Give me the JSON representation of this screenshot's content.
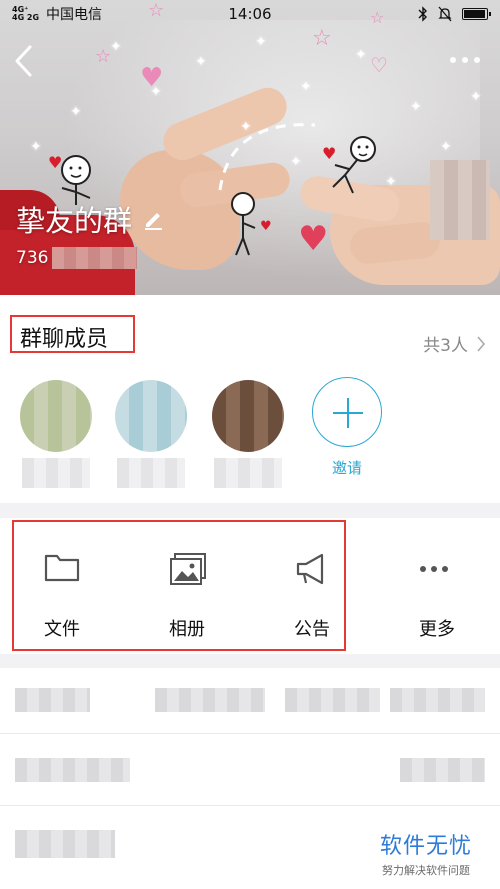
{
  "status_bar": {
    "signal": "4G⁺ 4G\n2G",
    "carrier": "中国电信",
    "time": "14:06"
  },
  "header": {
    "group_name": "挚友的群",
    "group_id_prefix": "736"
  },
  "members": {
    "title": "群聊成员",
    "count_label": "共3人",
    "invite_label": "邀请"
  },
  "actions": [
    {
      "label": "文件",
      "icon": "folder-icon"
    },
    {
      "label": "相册",
      "icon": "album-icon"
    },
    {
      "label": "公告",
      "icon": "megaphone-icon"
    },
    {
      "label": "更多",
      "icon": "more-dots-icon"
    }
  ],
  "watermark": {
    "title": "软件无忧",
    "subtitle": "努力解决软件问题"
  },
  "colors": {
    "accent": "#2aa7d3",
    "highlight_box": "#e53935",
    "watermark": "#2c7bd8"
  }
}
